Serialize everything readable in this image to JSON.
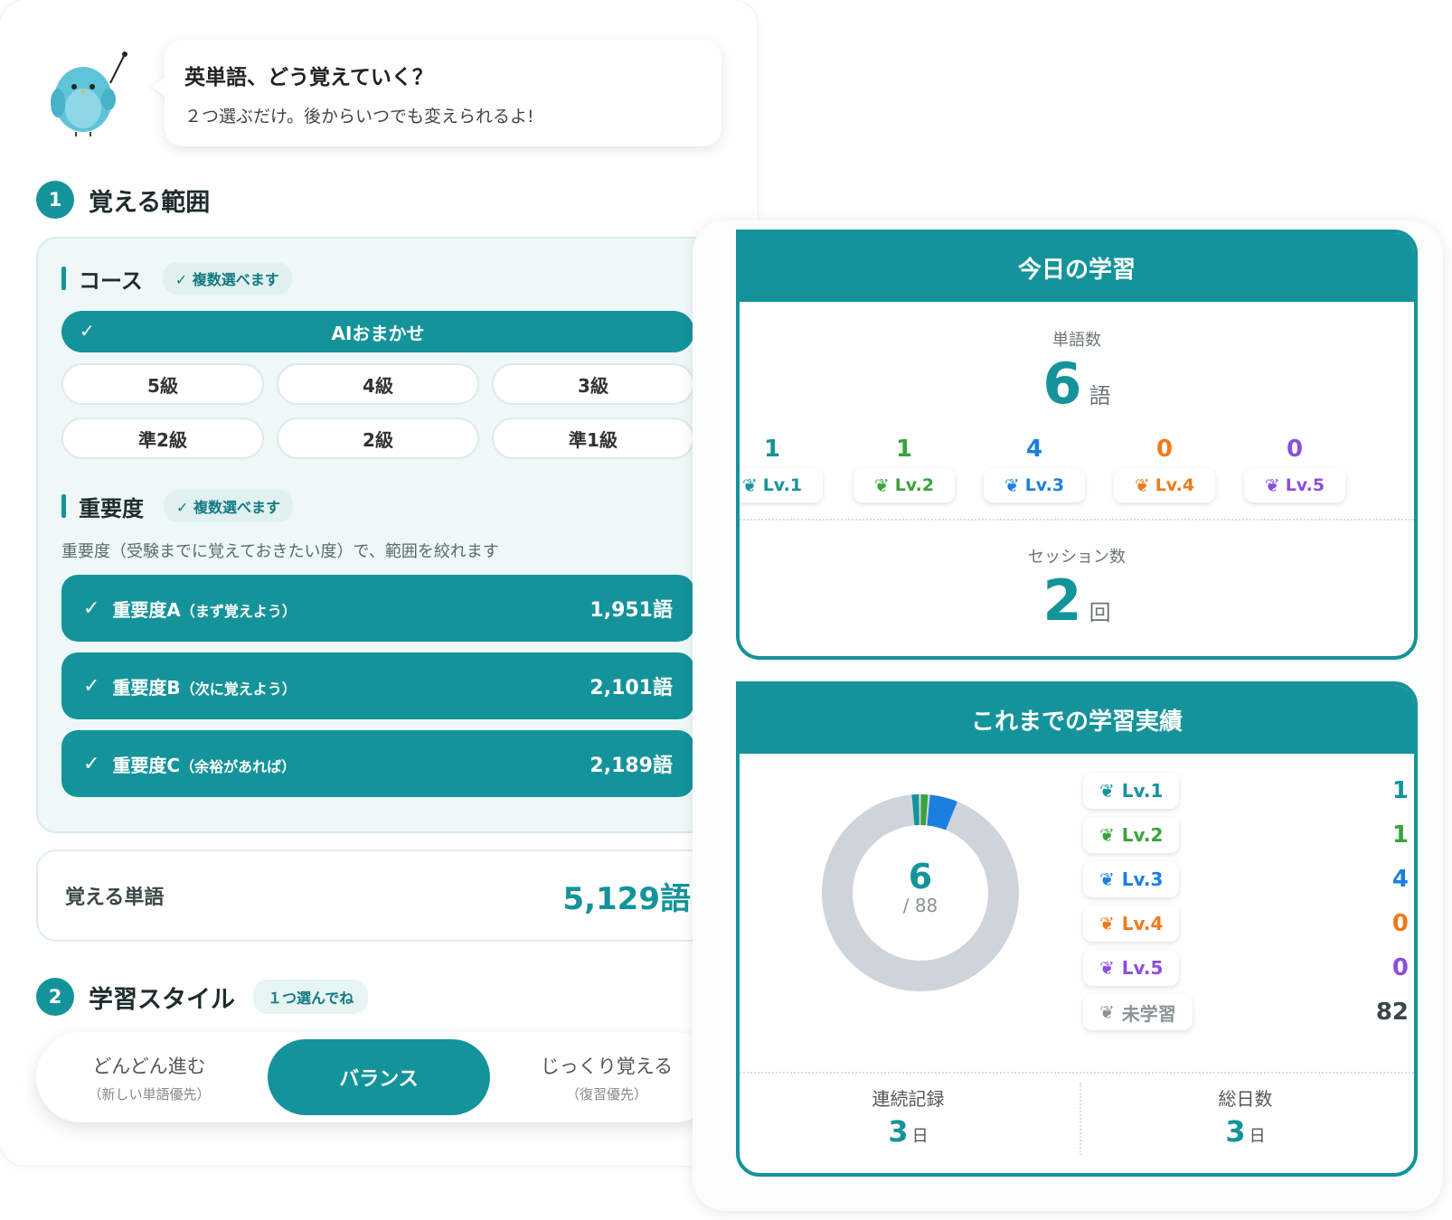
{
  "bubble": {
    "title": "英単語、どう覚えていく？",
    "subtitle": "２つ選ぶだけ。後からいつでも変えられるよ!"
  },
  "step1": {
    "num": "1",
    "title": "覚える範囲"
  },
  "course": {
    "label": "コース",
    "multi": "✓ 複数選べます",
    "ai": {
      "label": "AIおまかせ",
      "selected": true
    },
    "grades": [
      {
        "label": "5級",
        "selected": false
      },
      {
        "label": "4級",
        "selected": false
      },
      {
        "label": "3級",
        "selected": false
      },
      {
        "label": "準2級",
        "selected": false
      },
      {
        "label": "2級",
        "selected": false
      },
      {
        "label": "準1級",
        "selected": false
      }
    ]
  },
  "importance": {
    "label": "重要度",
    "multi": "✓ 複数選べます",
    "desc": "重要度（受験までに覚えておきたい度）で、範囲を絞れます",
    "items": [
      {
        "name": "重要度A",
        "note": "（まず覚えよう）",
        "count": "1,951語",
        "selected": true
      },
      {
        "name": "重要度B",
        "note": "（次に覚えよう）",
        "count": "2,101語",
        "selected": true
      },
      {
        "name": "重要度C",
        "note": "（余裕があれば）",
        "count": "2,189語",
        "selected": true
      }
    ]
  },
  "total": {
    "label": "覚える単語",
    "value": "5,129語"
  },
  "step2": {
    "num": "2",
    "title": "学習スタイル",
    "tag": "１つ選んでね"
  },
  "style": {
    "options": [
      {
        "main": "どんどん進む",
        "sub": "（新しい単語優先）",
        "selected": false
      },
      {
        "main": "バランス",
        "sub": "",
        "selected": true
      },
      {
        "main": "じっくり覚える",
        "sub": "（復習優先）",
        "selected": false
      }
    ]
  },
  "today": {
    "title": "今日の学習",
    "words_label": "単語数",
    "words_value": "6",
    "words_unit": "語",
    "levels": [
      {
        "count": "1",
        "label": "Lv.1",
        "color": "#14939a"
      },
      {
        "count": "1",
        "label": "Lv.2",
        "color": "#3aa33a"
      },
      {
        "count": "4",
        "label": "Lv.3",
        "color": "#1b7fe0"
      },
      {
        "count": "0",
        "label": "Lv.4",
        "color": "#f07a1a"
      },
      {
        "count": "0",
        "label": "Lv.5",
        "color": "#8a4fe0"
      }
    ],
    "sessions_label": "セッション数",
    "sessions_value": "2",
    "sessions_unit": "回"
  },
  "history": {
    "title": "これまでの学習実績",
    "learned": "6",
    "total": "/ 88",
    "legend": [
      {
        "label": "Lv.1",
        "value": "1",
        "color": "#14939a"
      },
      {
        "label": "Lv.2",
        "value": "1",
        "color": "#3aa33a"
      },
      {
        "label": "Lv.3",
        "value": "4",
        "color": "#1b7fe0"
      },
      {
        "label": "Lv.4",
        "value": "0",
        "color": "#f07a1a"
      },
      {
        "label": "Lv.5",
        "value": "0",
        "color": "#8a4fe0"
      },
      {
        "label": "未学習",
        "value": "82",
        "color": "#9aa3a5"
      }
    ],
    "streak_label": "連続記録",
    "streak_value": "3",
    "streak_unit": "日",
    "days_label": "総日数",
    "days_value": "3",
    "days_unit": "日"
  },
  "colors": {
    "accent": "#14939a",
    "unlearned": "#cfd3da"
  }
}
